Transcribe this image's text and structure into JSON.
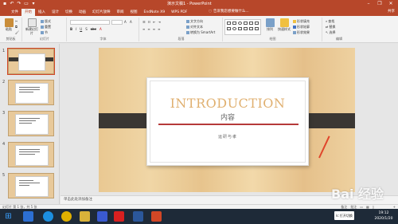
{
  "window": {
    "title": "演示文稿1 - PowerPoint",
    "qat_icons": [
      "save-icon",
      "undo-icon",
      "redo-icon",
      "start-presentation-icon",
      "customize-icon"
    ],
    "controls": [
      "–",
      "❐",
      "✕"
    ]
  },
  "tabs": [
    "文件",
    "开始",
    "插入",
    "设计",
    "切换",
    "动画",
    "幻灯片放映",
    "审阅",
    "视图",
    "EndNote X9",
    "WPS PDF"
  ],
  "active_tab": "开始",
  "tellme": "告诉我您想要做什么...",
  "share": "共享",
  "ribbon": {
    "clipboard": {
      "paste": "粘贴",
      "label": "剪贴板"
    },
    "slides": {
      "new_slide": "新建幻灯片",
      "layout": "版式",
      "reset": "重置",
      "section": "节",
      "label": "幻灯片"
    },
    "font": {
      "label": "字体"
    },
    "paragraph": {
      "text_direction": "文字方向",
      "align_text": "对齐文本",
      "smartart": "转换为 SmartArt",
      "label": "段落"
    },
    "drawing": {
      "arrange": "排列",
      "quick_styles": "快速样式",
      "fill": "形状填充",
      "outline": "形状轮廓",
      "effects": "形状效果",
      "label": "绘图"
    },
    "editing": {
      "find": "查找",
      "replace": "替换",
      "select": "选择",
      "label": "编辑"
    }
  },
  "thumbnails": [
    {
      "num": "1",
      "kind": "title"
    },
    {
      "num": "2",
      "kind": "list"
    },
    {
      "num": "3",
      "kind": "list"
    },
    {
      "num": "4",
      "kind": "list"
    },
    {
      "num": "5",
      "kind": "list"
    }
  ],
  "slide": {
    "title": "INTRODUCTION",
    "subtitle_cn": "内容",
    "caption": "运研与孝"
  },
  "notes_placeholder": "单击此处添加备注",
  "status": {
    "left": "幻灯片 第 1 张，共 5 张",
    "notes_btn": "备注",
    "comments_btn": "批注",
    "zoom": "+"
  },
  "taskbar": {
    "ime": "Ic 打开切换",
    "time": "19:12",
    "date": "2020/1/20"
  },
  "watermark": "Bai 经验"
}
